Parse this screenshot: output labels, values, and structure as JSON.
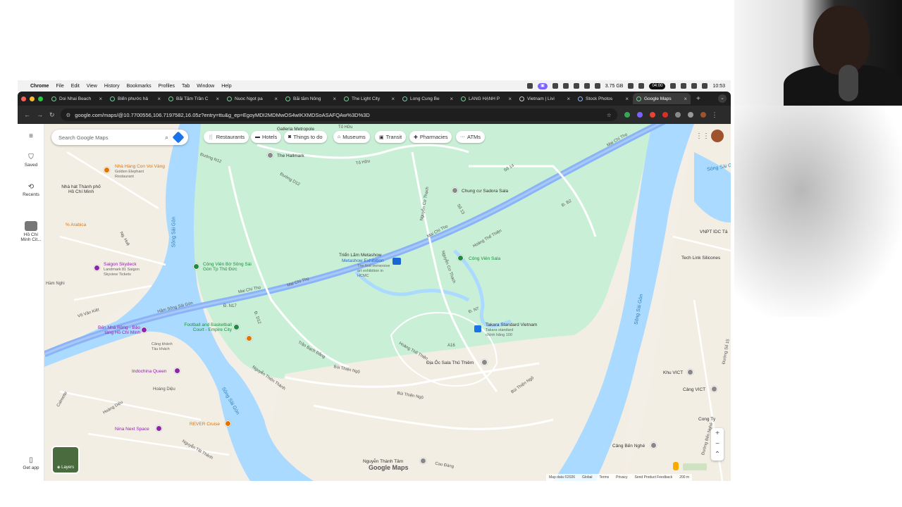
{
  "menubar": {
    "app": "Chrome",
    "items": [
      "File",
      "Edit",
      "View",
      "History",
      "Bookmarks",
      "Profiles",
      "Tab",
      "Window",
      "Help"
    ],
    "memory": "3.75 GB",
    "timer": "04:00",
    "clock": "10:53"
  },
  "tabs": [
    {
      "title": "Doi Nhai Beach"
    },
    {
      "title": "Biển phước hả"
    },
    {
      "title": "Bãi Tắm Trần C"
    },
    {
      "title": "Nuoc Ngot pa"
    },
    {
      "title": "Bãi tắm Nông"
    },
    {
      "title": "The Light City"
    },
    {
      "title": "Long Cung Be"
    },
    {
      "title": "LÀNG HẠNH P"
    },
    {
      "title": "Vietnam | Livi"
    },
    {
      "title": "Stock Photos"
    },
    {
      "title": "Google Maps",
      "active": true
    }
  ],
  "toolbar": {
    "url": "google.com/maps/@10.7700556,106.7197582,16.05z?entry=ttu&g_ep=EgoyMDI2MDMwOS4wIKXMDSoASAFQAw%3D%3D"
  },
  "sidebar": {
    "items": [
      {
        "label": "Saved",
        "icon": "bookmark-icon"
      },
      {
        "label": "Recents",
        "icon": "history-icon"
      },
      {
        "label": "Hồ Chí Minh Cit...",
        "icon": "city-thumbnail"
      },
      {
        "label": "Get app",
        "icon": "phone-icon"
      }
    ]
  },
  "search": {
    "placeholder": "Search Google Maps"
  },
  "chips": [
    {
      "label": "Restaurants",
      "icon": "fork-knife-icon"
    },
    {
      "label": "Hotels",
      "icon": "bed-icon"
    },
    {
      "label": "Things to do",
      "icon": "camera-icon"
    },
    {
      "label": "Museums",
      "icon": "museum-icon"
    },
    {
      "label": "Transit",
      "icon": "train-icon"
    },
    {
      "label": "Pharmacies",
      "icon": "pharmacy-icon"
    },
    {
      "label": "ATMs",
      "icon": "dots-icon"
    }
  ],
  "map": {
    "labels": {
      "galleria": "Galleria Metropole",
      "hallmark": "The Hallmark",
      "nha_hang": "Nhà Hàng Con Voi Vàng",
      "golden": "Golden Elephant Restaurant",
      "nha_hat": "Nhà hát Thành phố Hồ Chí Minh",
      "arabica": "% Arabica",
      "skydeck": "Saigon Skydeck",
      "skydeck_sub": "Landmark 81 Saigon Skyview Tickets",
      "ham_nghi": "Hàm Nghi",
      "vo_van_kiet": "Võ Văn Kiệt",
      "ben_nha_rong": "Bến Nhà Rồng - Bảo tàng Hồ Chí Minh",
      "indochina": "Indochina Queen",
      "nina": "Nina Next Space",
      "rever": "REVER Cruise",
      "song_sai_gon_1": "Sông Sài Gòn",
      "song_sai_gon_2": "Sông Sài Gòn",
      "song_sai_gon_3": "Sông Sài Gòn",
      "song_sai_gon_4": "Sông Sài Gòn",
      "cong_vien_bo_song": "Công Viên Bờ Sông Sài Gòn Tp Thủ Đức",
      "mai_chi_tho_1": "Mai Chí Thọ",
      "mai_chi_tho_2": "Mai Chí Thọ",
      "mai_chi_tho_3": "Mai Chí Thọ",
      "mai_chi_tho_4": "Mai Chí Thọ",
      "ham_song_sai_gon": "Hầm Sông Sài Gòn",
      "to_huu_1": "Tố Hữu",
      "to_huu_2": "Tố Hữu",
      "trien_lam": "Triển Lãm Metashow",
      "metashow": "Metashow Exhibition",
      "metashow_sub": "The first immersive art exhibition in HCMC",
      "sadora": "Chung cư Sadora Sala",
      "cong_vien_sala": "Công Viên Sala",
      "takara": "Takara Standard Vietnam",
      "takara_sub": "Takara standard chính hãng 100",
      "dia_oc": "Địa Ốc Sala Thủ Thiêm",
      "football": "Football and Basketball Court - Empire City",
      "nguyen_co_thach_1": "Nguyễn Cơ Thạch",
      "nguyen_co_thach_2": "Nguyễn Cơ Thạch",
      "nguyen_thien_thanh": "Nguyễn Thiện Thành",
      "bui_thien_ngo_1": "Bùi Thiện Ngộ",
      "bui_thien_ngo_2": "Bùi Thiện Ngộ",
      "bui_thien_ngo_3": "Bùi Thiện Ngộ",
      "tran_bach_dang": "Trần Bạch Đằng",
      "hoang_the_thien_1": "Hoàng Thế Thiện",
      "hoang_the_thien_2": "Hoàng Thế Thiện",
      "vnpt": "VNPT IDC Tâ",
      "tech_link": "Tech Link Silicones",
      "khu_vict": "Khu VICT",
      "cang_vict": "Cảng VICT",
      "cong_ty": "Cong Ty",
      "cang_ben_nghe": "Cảng Bến Nghé",
      "nguyen_thanh_tam": "Nguyễn Thành Tâm",
      "cao_dang": "Cao Đàng",
      "d_n12": "Đường N12",
      "d_d12": "Đường D12",
      "d_n17": "Đ. N17",
      "d_n7": "Đ. N7",
      "d_d12b": "Đ. D12",
      "d_s14": "Số 14",
      "d_s13": "Số 13",
      "d_b2": "Đ. B2",
      "d_a16": "A16",
      "tan_thuan": "Tân Thuận",
      "duong_s15": "Đường Số 15",
      "duong_ben_nghe": "Đường Bến Nghé",
      "cang_khanh": "Cảng khánh Tàu khách",
      "hoang_dieu": "Hoàng Diệu",
      "calmette": "Calmette",
      "nguyen_hue": "Ng. Huệ",
      "hoang_dieu2": "Hoàng Diệu",
      "nguyen_tat_thanh": "Nguyễn Tất Thành"
    },
    "layers_label": "Layers",
    "watermark": "Google Maps",
    "attribution": [
      "Map data ©2026",
      "Global",
      "Terms",
      "Privacy",
      "Send Product Feedback",
      "200 m"
    ]
  },
  "colors": {
    "water": "#aadaff",
    "park": "#c9f0d6",
    "land": "#f4efe6",
    "highway": "#8ab4f8",
    "road": "#ffffff"
  }
}
